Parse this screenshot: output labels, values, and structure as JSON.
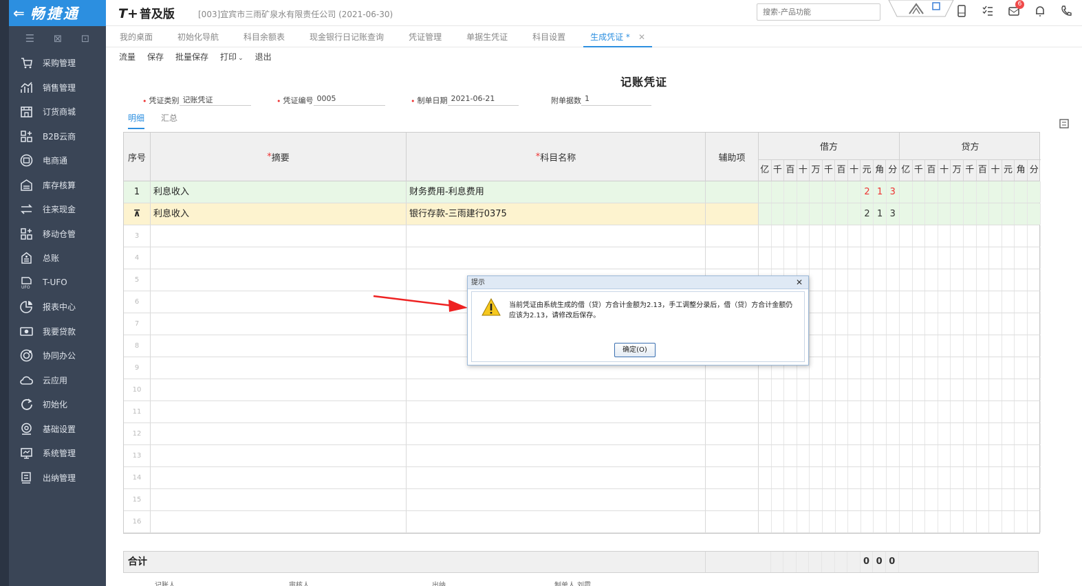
{
  "sidebar": {
    "brand": "畅捷通",
    "items": [
      {
        "label": "采购管理",
        "icon": "purchase-icon"
      },
      {
        "label": "销售管理",
        "icon": "sales-icon"
      },
      {
        "label": "订货商城",
        "icon": "store-icon"
      },
      {
        "label": "B2B云商",
        "icon": "b2b-icon"
      },
      {
        "label": "电商通",
        "icon": "ecommerce-icon"
      },
      {
        "label": "库存核算",
        "icon": "inventory-icon"
      },
      {
        "label": "往来现金",
        "icon": "cash-icon"
      },
      {
        "label": "移动仓管",
        "icon": "mobile-warehouse-icon"
      },
      {
        "label": "总账",
        "icon": "ledger-icon"
      },
      {
        "label": "T-UFO",
        "icon": "ufo-icon"
      },
      {
        "label": "报表中心",
        "icon": "report-icon"
      },
      {
        "label": "我要贷款",
        "icon": "loan-icon"
      },
      {
        "label": "协同办公",
        "icon": "office-icon"
      },
      {
        "label": "云应用",
        "icon": "cloud-icon"
      },
      {
        "label": "初始化",
        "icon": "init-icon"
      },
      {
        "label": "基础设置",
        "icon": "settings-icon"
      },
      {
        "label": "系统管理",
        "icon": "system-icon"
      },
      {
        "label": "出纳管理",
        "icon": "cashier-icon"
      }
    ]
  },
  "header": {
    "logo": "T+",
    "edition": "普及版",
    "company": "[003]宜宾市三雨矿泉水有限责任公司  (2021-06-30)",
    "search_placeholder": "搜索-产品功能",
    "notification_count": "6"
  },
  "tabs": [
    {
      "label": "我的桌面",
      "active": false
    },
    {
      "label": "初始化导航",
      "active": false
    },
    {
      "label": "科目余额表",
      "active": false
    },
    {
      "label": "现金银行日记账查询",
      "active": false
    },
    {
      "label": "凭证管理",
      "active": false
    },
    {
      "label": "单据生凭证",
      "active": false
    },
    {
      "label": "科目设置",
      "active": false
    },
    {
      "label": "生成凭证 *",
      "active": true
    }
  ],
  "toolbar": [
    "流量",
    "保存",
    "批量保存",
    "打印",
    "退出"
  ],
  "voucher": {
    "title": "记账凭证",
    "type_label": "凭证类别",
    "type_value": "记账凭证",
    "number_label": "凭证编号",
    "number_value": "0005",
    "date_label": "制单日期",
    "date_value": "2021-06-21",
    "attach_label": "附单据数",
    "attach_value": "1",
    "subtabs": [
      "明细",
      "汇总"
    ]
  },
  "grid": {
    "columns": {
      "seq": "序号",
      "summary": "摘要",
      "account": "科目名称",
      "aux": "辅助项",
      "debit": "借方",
      "credit": "贷方"
    },
    "digit_headers": [
      "亿",
      "千",
      "百",
      "十",
      "万",
      "千",
      "百",
      "十",
      "元",
      "角",
      "分"
    ],
    "rows": [
      {
        "seq": "1",
        "summary": "利息收入",
        "account": "财务费用-利息费用",
        "debit_digits": [
          "",
          "",
          "",
          "",
          "",
          "",
          "",
          "",
          "2",
          "1",
          "3"
        ],
        "credit_digits": [
          "",
          "",
          "",
          "",
          "",
          "",
          "",
          "",
          "",
          "",
          ""
        ]
      },
      {
        "seq": "",
        "summary": "利息收入",
        "account": "银行存款-三雨建行0375",
        "debit_digits": [
          "",
          "",
          "",
          "",
          "",
          "",
          "",
          "",
          "2",
          "1",
          "3"
        ],
        "credit_digits": [
          "",
          "",
          "",
          "",
          "",
          "",
          "",
          "",
          "",
          "",
          ""
        ]
      },
      {
        "seq": "3"
      },
      {
        "seq": "4"
      },
      {
        "seq": "5"
      },
      {
        "seq": "6"
      },
      {
        "seq": "7"
      },
      {
        "seq": "8"
      },
      {
        "seq": "9"
      },
      {
        "seq": "10"
      },
      {
        "seq": "11"
      },
      {
        "seq": "12"
      },
      {
        "seq": "13"
      },
      {
        "seq": "14"
      },
      {
        "seq": "15"
      },
      {
        "seq": "16"
      }
    ],
    "total_label": "合计",
    "total_debit_digits": [
      "",
      "",
      "",
      "",
      "",
      "",
      "",
      "",
      "0",
      "0",
      "0"
    ]
  },
  "footer_labels": [
    "记账人",
    "审核人",
    "出纳",
    "制单人 刘霞"
  ],
  "dialog": {
    "title": "提示",
    "message": "当前凭证由系统生成的借（贷）方合计金额为2.13，手工调整分录后，借（贷）方合计金额仍应该为2.13，请修改后保存。",
    "ok_label": "确定(O)"
  },
  "colors": {
    "brand": "#2c8fe0",
    "sidebar": "#3a4556",
    "row_green": "#e8f7e6",
    "row_yellow": "#fdf3cf",
    "red_digit": "#e33333"
  }
}
